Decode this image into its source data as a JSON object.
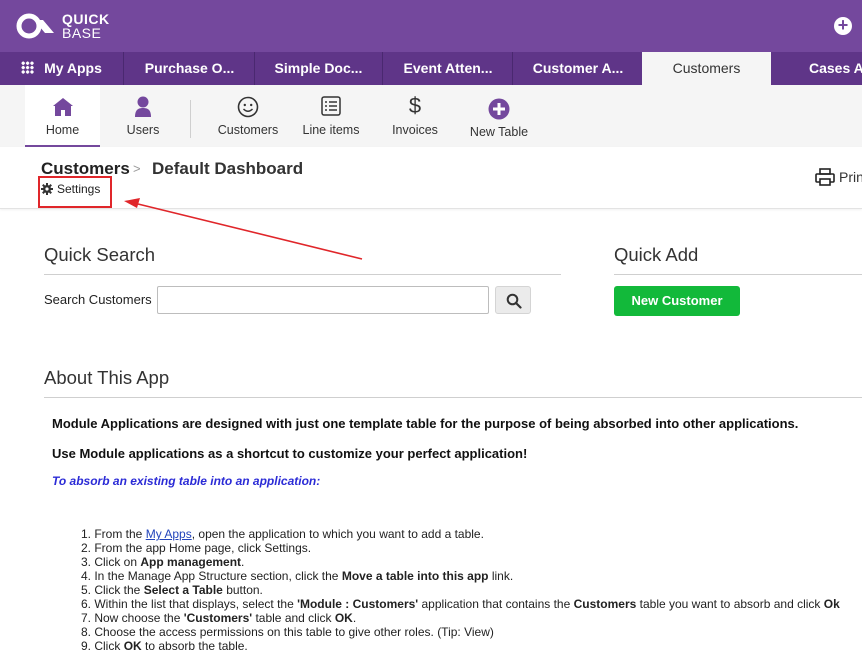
{
  "brand": {
    "line1": "QUICK",
    "line2": "BASE"
  },
  "colors": {
    "purple": "#74489d",
    "purple_dark": "#5f3588",
    "green": "#12b93a",
    "annotation_red": "#e0262a",
    "link_blue": "#2b2bd6"
  },
  "tabs": [
    {
      "label": "My Apps",
      "icon": "grid-icon"
    },
    {
      "label": "Purchase O..."
    },
    {
      "label": "Simple Doc..."
    },
    {
      "label": "Event Atten..."
    },
    {
      "label": "Customer A..."
    },
    {
      "label": "Customers",
      "active": true
    },
    {
      "label": "Cases Ap"
    }
  ],
  "pagebar": [
    {
      "label": "Home",
      "icon": "home-icon",
      "active": true
    },
    {
      "label": "Users",
      "icon": "user-icon"
    },
    {
      "label": "Customers",
      "icon": "smiley-icon"
    },
    {
      "label": "Line items",
      "icon": "list-icon"
    },
    {
      "label": "Invoices",
      "icon": "dollar-icon"
    },
    {
      "label": "New Table",
      "icon": "plus-circle-icon"
    }
  ],
  "header": {
    "table_name": "Customers",
    "separator": ">",
    "page_name": "Default Dashboard",
    "settings_label": "Settings",
    "print_label": "Prin"
  },
  "quick_search": {
    "title": "Quick Search",
    "label": "Search Customers",
    "value": ""
  },
  "quick_add": {
    "title": "Quick Add",
    "button_label": "New Customer"
  },
  "about": {
    "title": "About This App",
    "para1": "Module Applications are designed with just one template table for the purpose of being absorbed into other applications.",
    "para2": "Use Module applications as a shortcut to customize your perfect application!",
    "subheading": "To absorb an existing table into an application:",
    "steps": [
      {
        "n": "1.",
        "pre": "From the ",
        "link": "My Apps",
        "post": ", open the application to which you want to add a table."
      },
      {
        "n": "2.",
        "text": "From the app Home page, click Settings."
      },
      {
        "n": "3.",
        "pre": "Click on ",
        "bold": "App management",
        "post": "."
      },
      {
        "n": "4.",
        "pre": "In the Manage App Structure section, click the ",
        "bold": "Move a table into this app",
        "post": " link."
      },
      {
        "n": "5.",
        "pre": "Click the ",
        "bold": "Select a Table",
        "post": " button."
      },
      {
        "n": "6.",
        "pre": "Within the list that displays, select the ",
        "bold": "'Module : Customers'",
        "mid": " application that contains the ",
        "bold2": "Customers",
        "post": " table you want to absorb and click ",
        "bold3": "Ok"
      },
      {
        "n": "7.",
        "pre": "Now choose the ",
        "bold": "'Customers'",
        "post": " table and click ",
        "bold2": "OK",
        "post2": "."
      },
      {
        "n": "8.",
        "text": "Choose the access permissions on this table to give other roles. (Tip: View)"
      },
      {
        "n": "9.",
        "pre": "Click ",
        "bold": "OK",
        "post": " to absorb the table."
      }
    ]
  }
}
